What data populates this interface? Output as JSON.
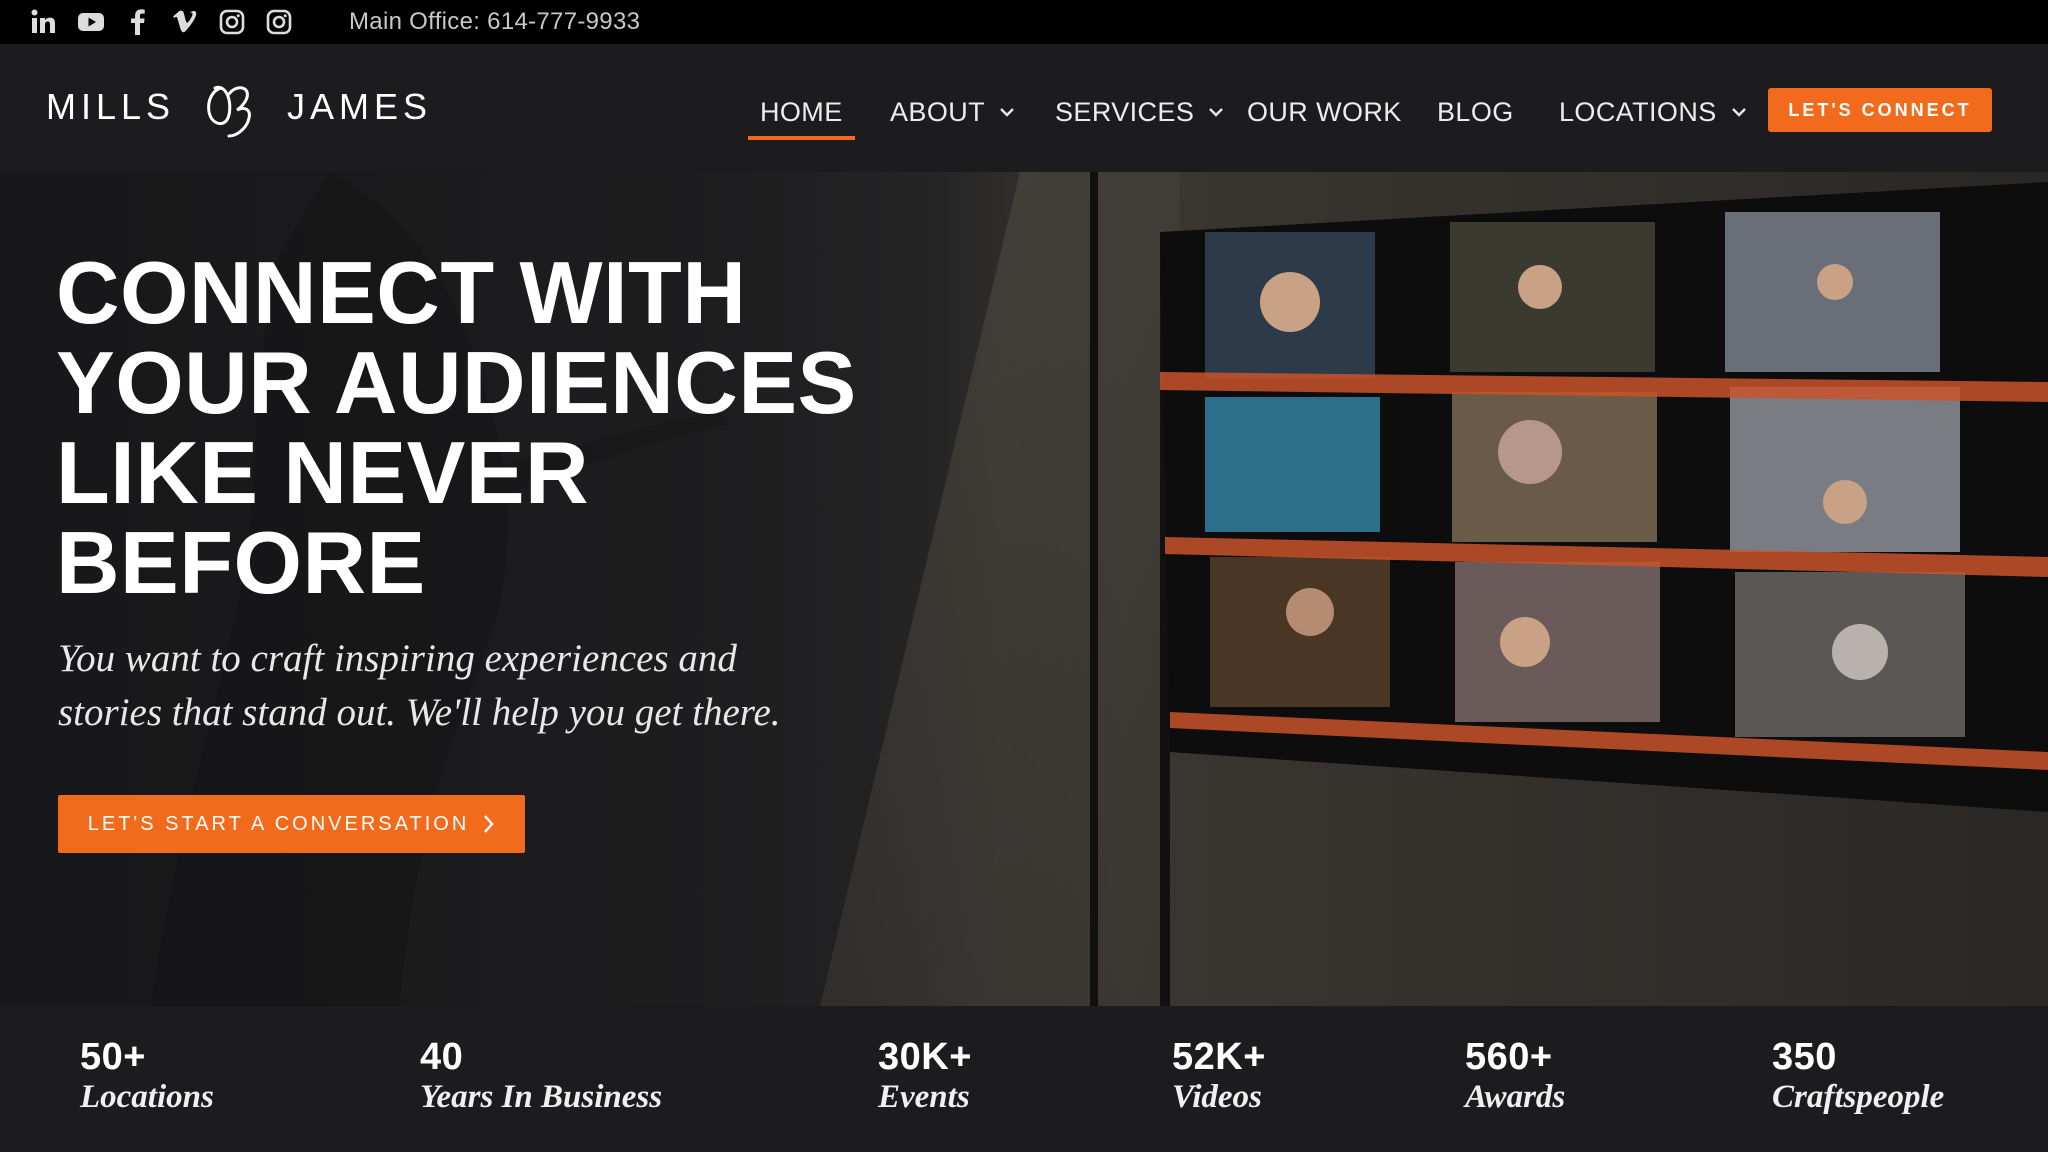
{
  "topbar": {
    "social_icons": [
      "linkedin-icon",
      "youtube-icon",
      "facebook-icon",
      "vimeo-icon",
      "instagram-icon",
      "instagram-icon"
    ],
    "office_text": "Main Office: 614-777-9933"
  },
  "header": {
    "logo": {
      "left_word": "MILLS",
      "right_word": "JAMES"
    },
    "nav": {
      "home": "HOME",
      "about": "ABOUT",
      "services": "SERVICES",
      "our_work": "OUR WORK",
      "blog": "BLOG",
      "locations": "LOCATIONS",
      "active": "HOME"
    },
    "cta_label": "LET'S CONNECT"
  },
  "hero": {
    "title_lines": [
      "CONNECT WITH",
      "YOUR AUDIENCES",
      "LIKE NEVER",
      "BEFORE"
    ],
    "subtitle_lines": [
      "You want to craft inspiring experiences and",
      "stories that stand out. We'll help you get there."
    ],
    "cta_label": "LET'S START A CONVERSATION"
  },
  "stats": [
    {
      "value": "50+",
      "label": "Locations"
    },
    {
      "value": "40",
      "label": "Years In Business"
    },
    {
      "value": "30K+",
      "label": "Events"
    },
    {
      "value": "52K+",
      "label": "Videos"
    },
    {
      "value": "560+",
      "label": "Awards"
    },
    {
      "value": "350",
      "label": "Craftspeople"
    }
  ],
  "colors": {
    "accent": "#f26a1b",
    "topbar_bg": "#000000",
    "header_bg": "#1c1c1e",
    "text": "#ffffff"
  }
}
